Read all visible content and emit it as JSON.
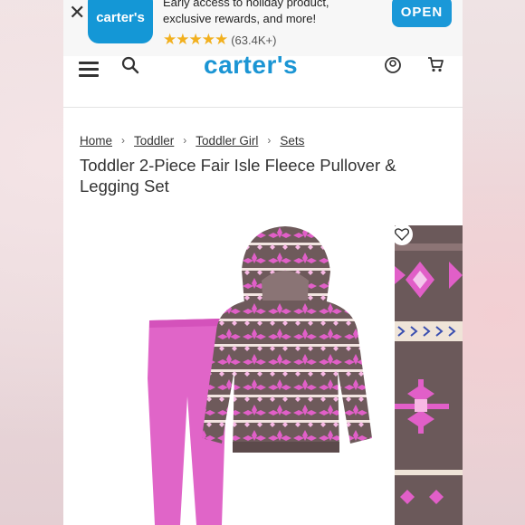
{
  "app_banner": {
    "close_symbol": "✕",
    "app_name": "carter's",
    "promo_text": "Early access to holiday product, exclusive rewards, and more!",
    "stars": "★★★★★",
    "rating_count": "(63.4K+)",
    "open_label": "OPEN",
    "accent_color": "#1a98d8"
  },
  "header": {
    "logo_text": "carter's",
    "icons": [
      "menu-icon",
      "search-icon",
      "account-icon",
      "cart-icon"
    ]
  },
  "breadcrumb": {
    "items": [
      "Home",
      "Toddler",
      "Toddler Girl",
      "Sets"
    ],
    "separator": "›"
  },
  "product": {
    "title": "Toddler 2-Piece Fair Isle Fleece Pullover & Legging Set",
    "colors": {
      "legging": "#e065c8",
      "pullover": "#6e5a5b",
      "accent_pink": "#e15fc8"
    }
  }
}
